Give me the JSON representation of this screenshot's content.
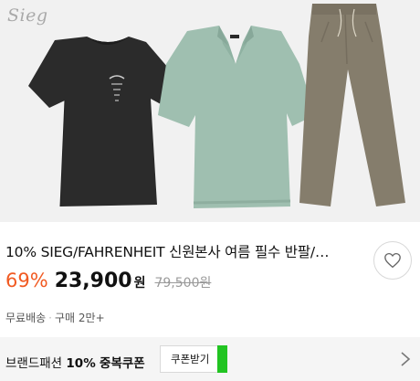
{
  "product": {
    "brand_logo": "Sieg",
    "image_alt": "Black t-shirt, mint polo shirt and khaki pants set",
    "title": "10% SIEG/FAHRENHEIT 신원본사 여름 필수 반팔/…",
    "discount": "69%",
    "price": "23,900",
    "currency": "원",
    "original_price": "79,500원",
    "shipping": "무료배송",
    "purchases": "구매 2만+"
  },
  "coupon": {
    "prefix": "브랜드패션",
    "percent": "10%",
    "suffix": "중복쿠폰",
    "button_label": "쿠폰받기"
  },
  "colors": {
    "discount": "#f15a22",
    "coupon_accent": "#22c422",
    "tee": "#2b2b2b",
    "polo": "#9fbfb0",
    "pants": "#857d6c"
  },
  "icons": [
    "heart-icon",
    "chevron-right-icon"
  ]
}
